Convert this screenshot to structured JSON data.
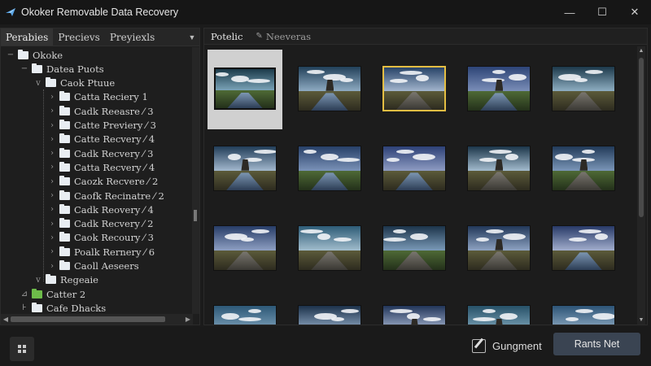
{
  "window": {
    "title": "Okoker Removable Data Recovery",
    "minimize": "—",
    "maximize": "☐",
    "close": "✕"
  },
  "left_tabs": {
    "items": [
      "Perabies",
      "Precievs",
      "Preyiexls"
    ],
    "active_index": 0
  },
  "tree": {
    "items": [
      {
        "label": "Okoke",
        "level": 0,
        "toggle": "−",
        "icon": "folder"
      },
      {
        "label": "Datea Puots",
        "level": 1,
        "toggle": "−",
        "icon": "folder"
      },
      {
        "label": "Caok Ptuue",
        "level": 2,
        "toggle": "v",
        "icon": "folder"
      },
      {
        "label": "Catta Reciery 1",
        "level": 3,
        "toggle": "›",
        "icon": "folder"
      },
      {
        "label": "Cadk Reeasre ⁄ 3",
        "level": 3,
        "toggle": "›",
        "icon": "folder"
      },
      {
        "label": "Catte Previery ⁄ 3",
        "level": 3,
        "toggle": "›",
        "icon": "folder"
      },
      {
        "label": "Catte Recvery ⁄ 4",
        "level": 3,
        "toggle": "›",
        "icon": "folder"
      },
      {
        "label": "Cadk Recvery ⁄ 3",
        "level": 3,
        "toggle": "›",
        "icon": "folder"
      },
      {
        "label": "Catta Recvery ⁄ 4",
        "level": 3,
        "toggle": "›",
        "icon": "folder"
      },
      {
        "label": "Caozk Recvere ⁄ 2",
        "level": 3,
        "toggle": "›",
        "icon": "folder"
      },
      {
        "label": "Caofk Recinatre ⁄ 2",
        "level": 3,
        "toggle": "›",
        "icon": "folder"
      },
      {
        "label": "Cadk Reovery ⁄ 4",
        "level": 3,
        "toggle": "›",
        "icon": "folder"
      },
      {
        "label": "Cadk Recvery ⁄ 2",
        "level": 3,
        "toggle": "›",
        "icon": "folder"
      },
      {
        "label": "Caok Recoury ⁄ 3",
        "level": 3,
        "toggle": "›",
        "icon": "folder"
      },
      {
        "label": "Poalk Rernery ⁄ 6",
        "level": 3,
        "toggle": "›",
        "icon": "folder"
      },
      {
        "label": "Caoll Aeseers",
        "level": 3,
        "toggle": "›",
        "icon": "folder"
      },
      {
        "label": "Regeaie",
        "level": 2,
        "toggle": "v",
        "icon": "folder"
      },
      {
        "label": "Catter 2",
        "level": 1,
        "toggle": "⊿",
        "icon": "folder-green"
      },
      {
        "label": "Cafe Dhacks",
        "level": 1,
        "toggle": "⊦",
        "icon": "folder"
      }
    ]
  },
  "right_tabs": {
    "active": "Potelic",
    "inactive": "Neeveras"
  },
  "gallery": {
    "thumbnails": [
      {
        "kind": "water",
        "state": "selected"
      },
      {
        "kind": "water",
        "state": "normal"
      },
      {
        "kind": "road",
        "state": "highlighted"
      },
      {
        "kind": "water",
        "state": "normal"
      },
      {
        "kind": "road",
        "state": "normal"
      },
      {
        "kind": "water",
        "state": "normal"
      },
      {
        "kind": "water",
        "state": "normal"
      },
      {
        "kind": "water",
        "state": "normal"
      },
      {
        "kind": "road",
        "state": "normal"
      },
      {
        "kind": "road",
        "state": "normal"
      },
      {
        "kind": "road",
        "state": "normal"
      },
      {
        "kind": "road",
        "state": "normal"
      },
      {
        "kind": "road",
        "state": "normal"
      },
      {
        "kind": "road",
        "state": "normal"
      },
      {
        "kind": "water",
        "state": "normal"
      },
      {
        "kind": "water",
        "state": "normal"
      },
      {
        "kind": "road",
        "state": "normal"
      },
      {
        "kind": "water",
        "state": "normal"
      },
      {
        "kind": "water",
        "state": "normal"
      },
      {
        "kind": "water",
        "state": "normal"
      }
    ]
  },
  "bottom": {
    "secondary_label": "Gungment",
    "primary_label": "Rants Net"
  },
  "icons": {
    "app": "app-bird-icon",
    "grid": "grid-view-icon",
    "edit": "edit-checkbox-icon",
    "pin": "pin-icon",
    "folder": "folder-icon"
  },
  "colors": {
    "background": "#1b1b1b",
    "highlight_frame": "#e4be43",
    "primary_button": "#3a4452",
    "green_folder": "#6dbb4a"
  }
}
